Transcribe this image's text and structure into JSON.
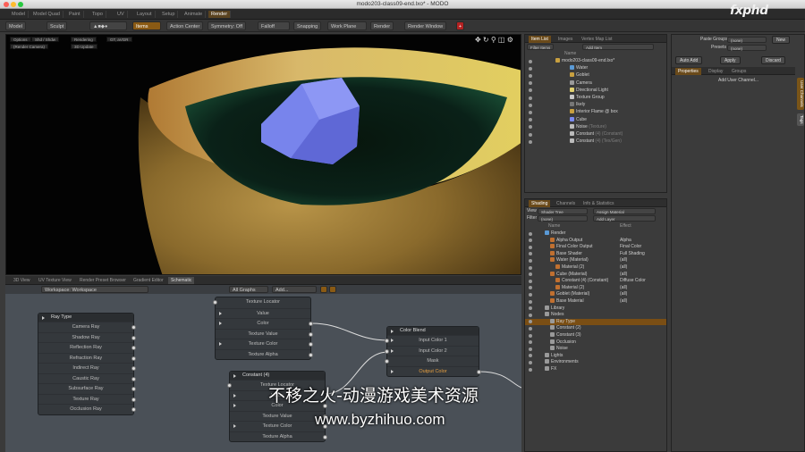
{
  "window": {
    "title": "modo203-class09-end.lxo* - MODO"
  },
  "logo": "fxphd",
  "menubar": {
    "items": [
      "Model",
      "Model Quad",
      "Paint",
      "Topo",
      "UV",
      "Layout",
      "Setup",
      "Animate",
      "Render"
    ],
    "active": "Render"
  },
  "toolbar": {
    "mode_model": "Model",
    "mode_sculpt": "Sculpt",
    "items": "Items",
    "action_center": "Action Center",
    "symmetry": "Symmetry: Off",
    "falloff": "Falloff",
    "snapping": "Snapping",
    "work_plane": "Work Plane",
    "render": "Render",
    "render_window": "Render Window"
  },
  "viewport": {
    "buttons": [
      "Options",
      "Shd / Shdw",
      "Rendering",
      "GT, aVGR",
      "(Render Camera)",
      "3D Update"
    ]
  },
  "bottom_tabs": [
    "3D View",
    "UV Texture View",
    "Render Preset Browser",
    "Gradient Editor",
    "Schematic"
  ],
  "bottom_tabs_active": "Schematic",
  "schematic": {
    "workspace": "Workspace: Workspace",
    "view_label": "All Graphs",
    "add_label": "Add...",
    "nodes": {
      "ray_type": {
        "title": "Ray Type",
        "rows": [
          "Camera Ray",
          "Shadow Ray",
          "Reflection Ray",
          "Refraction Ray",
          "Indirect Ray",
          "Caustic Ray",
          "Subsurface Ray",
          "Texture Ray",
          "Occlusion Ray"
        ]
      },
      "texture_locator": {
        "rows": [
          "Texture Locator",
          "Value",
          "Color",
          "Texture Value",
          "Texture Color",
          "Texture Alpha"
        ]
      },
      "color_blend": {
        "title": "Color Blend",
        "rows": [
          "Input Color 1",
          "Input Color 2",
          "Mask",
          "Output Color"
        ]
      },
      "constant": {
        "title": "Constant (4)",
        "rows": [
          "Texture Locator",
          "Value",
          "Color",
          "Texture Value",
          "Texture Color",
          "Texture Alpha"
        ]
      }
    }
  },
  "item_list": {
    "tabs": [
      "Item List",
      "Images",
      "Vertex Map List"
    ],
    "active": "Item List",
    "filter": "Filter Items",
    "add": "Add Item",
    "column": "Name",
    "items": [
      {
        "label": "modo203-class09-end.lxo*",
        "sub": ""
      },
      {
        "label": "Water",
        "sub": ""
      },
      {
        "label": "Goblet",
        "sub": ""
      },
      {
        "label": "Camera",
        "sub": ""
      },
      {
        "label": "Directional Light",
        "sub": ""
      },
      {
        "label": "Texture Group",
        "sub": ""
      },
      {
        "label": "Ikely",
        "sub": ""
      },
      {
        "label": "Interior Flame @ box",
        "sub": ""
      },
      {
        "label": "Cube",
        "sub": ""
      },
      {
        "label": "Noise",
        "sub": "(Texture)"
      },
      {
        "label": "Constant",
        "sub": "(4) (Constant)"
      },
      {
        "label": "Constant",
        "sub": "(4) (Tex/Gen)"
      }
    ]
  },
  "shading": {
    "tabs": [
      "Shading",
      "Channels",
      "Info & Statistics"
    ],
    "active": "Shading",
    "view_label": "View",
    "view_value": "Shader Tree",
    "filter_label": "Filter",
    "filter_value": "(none)",
    "assign": "Assign Material",
    "add_layer": "Add Layer",
    "col_name": "Name",
    "col_effect": "Effect",
    "rows": [
      {
        "name": "Render",
        "effect": ""
      },
      {
        "name": "Alpha Output",
        "effect": "Alpha"
      },
      {
        "name": "Final Color Output",
        "effect": "Final Color"
      },
      {
        "name": "Base Shader",
        "effect": "Full Shading"
      },
      {
        "name": "Water (Material)",
        "effect": "(all)"
      },
      {
        "name": "Material (2)",
        "effect": "(all)"
      },
      {
        "name": "Cube (Material)",
        "effect": "(all)"
      },
      {
        "name": "Constant (4) (Constant)",
        "effect": "Diffuse Color"
      },
      {
        "name": "Material (2)",
        "effect": "(all)"
      },
      {
        "name": "Goblet (Material)",
        "effect": "(all)"
      },
      {
        "name": "Base Material",
        "effect": "(all)"
      },
      {
        "name": "Library",
        "effect": ""
      },
      {
        "name": "Nodes",
        "effect": ""
      },
      {
        "name": "Ray Type",
        "effect": ""
      },
      {
        "name": "Constant (2)",
        "effect": ""
      },
      {
        "name": "Constant (3)",
        "effect": ""
      },
      {
        "name": "Occlusion",
        "effect": ""
      },
      {
        "name": "Noise",
        "effect": ""
      },
      {
        "name": "Lights",
        "effect": ""
      },
      {
        "name": "Environments",
        "effect": ""
      },
      {
        "name": "FX",
        "effect": ""
      }
    ]
  },
  "properties": {
    "paste_groups_label": "Paste Groups",
    "paste_groups_value": "(none)",
    "presets_label": "Presets",
    "presets_value": "(none)",
    "new": "New",
    "auto_add": "Auto Add",
    "apply": "Apply",
    "discard": "Discard",
    "tabs": [
      "Properties",
      "Display",
      "Groups"
    ],
    "active": "Properties",
    "add_user_channel": "Add User Channel...",
    "side_tabs": [
      "User Channels",
      "Tags"
    ]
  },
  "watermark": {
    "line1": "不移之火-动漫游戏美术资源",
    "line2": "www.byzhihuo.com"
  }
}
